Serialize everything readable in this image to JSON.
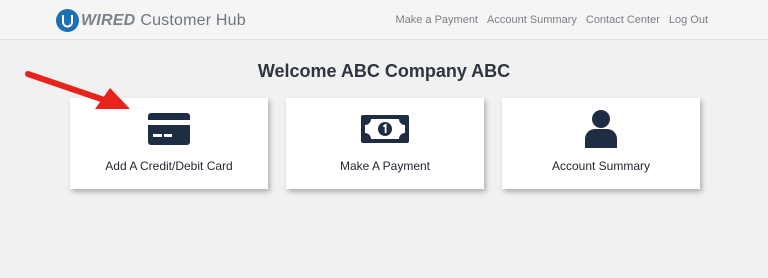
{
  "header": {
    "brand_mark": "WIRED",
    "brand_text": "Customer Hub",
    "nav": [
      "Make a Payment",
      "Account Summary",
      "Contact Center",
      "Log Out"
    ]
  },
  "main": {
    "welcome": "Welcome ABC Company ABC",
    "cards": [
      {
        "label": "Add A Credit/Debit Card",
        "icon": "credit-card-icon"
      },
      {
        "label": "Make A Payment",
        "icon": "banknote-icon"
      },
      {
        "label": "Account Summary",
        "icon": "user-icon"
      }
    ]
  },
  "colors": {
    "icon": "#1f2d44",
    "brand": "#1d6fb3",
    "arrow": "#e8231b",
    "background": "#f1f1f1"
  }
}
